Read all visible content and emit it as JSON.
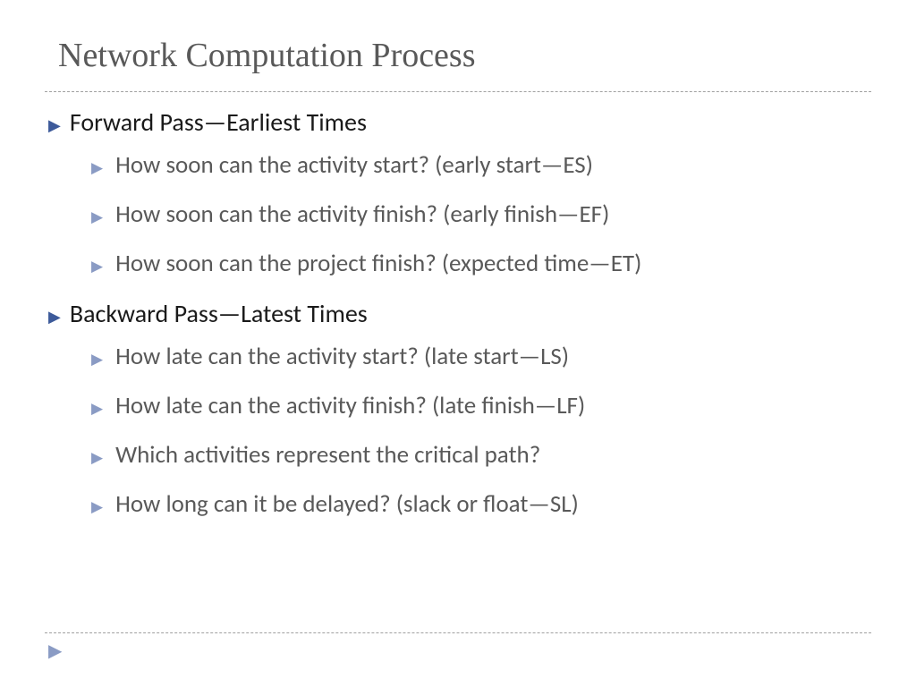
{
  "title": "Network Computation Process",
  "sections": [
    {
      "heading": "Forward Pass—Earliest Times",
      "items": [
        "How soon can the activity start? (early start—ES)",
        "How soon can the activity finish? (early finish—EF)",
        "How soon can the project finish? (expected time—ET)"
      ]
    },
    {
      "heading": "Backward Pass—Latest Times",
      "items": [
        "How late can the activity start? (late start—LS)",
        "How late can the activity finish? (late finish—LF)",
        "Which activities represent the critical path?",
        "How long can it be delayed? (slack or float—SL)"
      ]
    }
  ]
}
